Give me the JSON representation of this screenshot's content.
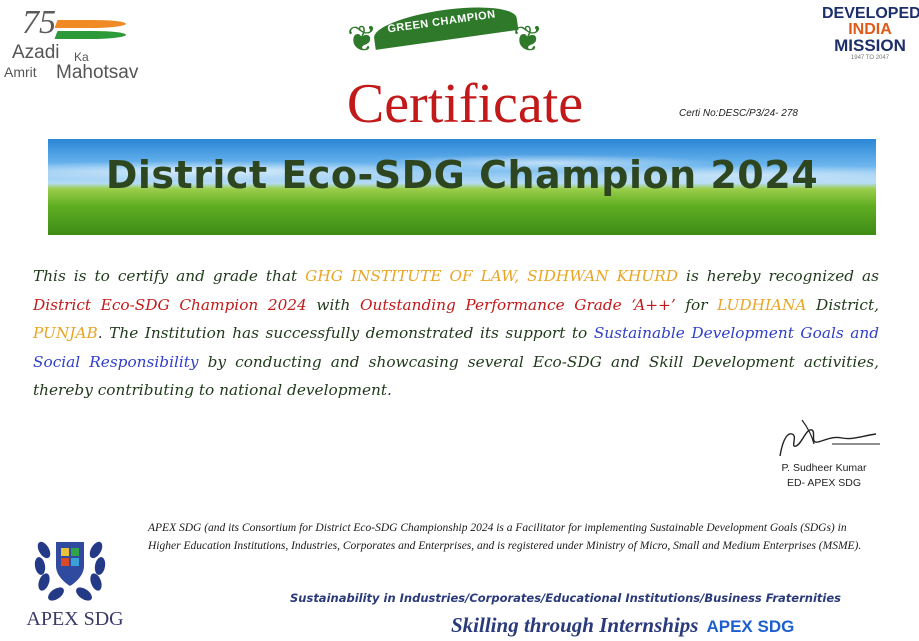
{
  "logos": {
    "azadi": {
      "number": "75",
      "line1": "Azadi",
      "line2": "Ka",
      "line3": "Amrit",
      "line4": "Mahotsav"
    },
    "badge_text": "GREEN CHAMPION",
    "developed_india": {
      "line1": "DEVELOPED",
      "line2": "INDIA",
      "line3": "MISSION",
      "line4": "1947 TO 2047"
    }
  },
  "certificate": {
    "title": "Certificate",
    "cert_no": "Certi No:DESC/P3/24- 278",
    "banner": "District Eco-SDG Champion 2024"
  },
  "body": {
    "p1": "This is to certify and grade that ",
    "institution": "GHG INSTITUTE OF LAW, SIDHWAN KHURD",
    "p2": " is hereby recognized as ",
    "award": "District Eco-SDG Champion 2024",
    "p3": " with ",
    "grade": "Outstanding Performance Grade ‘A++’",
    "p4": " for ",
    "district": "LUDHIANA",
    "p5": " District, ",
    "state": "PUNJAB",
    "p6": ". The Institution has successfully demonstrated its support to ",
    "goals": "Sustainable Development Goals and Social Responsibility",
    "p7": " by conducting and showcasing several Eco-SDG and Skill Development activities, thereby contributing to national development."
  },
  "signatory": {
    "name": "P. Sudheer Kumar",
    "role": "ED- APEX SDG"
  },
  "footer": {
    "org_name": "APEX SDG",
    "disclaimer": "APEX SDG (and its Consortium for District Eco-SDG Championship 2024 is a Facilitator for implementing Sustainable Development Goals (SDGs) in Higher Education Institutions, Industries, Corporates and Enterprises, and is registered under Ministry of Micro, Small and Medium Enterprises (MSME).",
    "tagline1": "Sustainability in Industries/Corporates/Educational Institutions/Business Fraternities",
    "tagline2": "Skilling through Internships",
    "tagline2_brand": "APEX SDG"
  },
  "colors": {
    "title_red": "#c21a1a",
    "highlight_orange": "#e8a525",
    "highlight_blue": "#2f3fc8",
    "text_green": "#1f3a1a"
  }
}
